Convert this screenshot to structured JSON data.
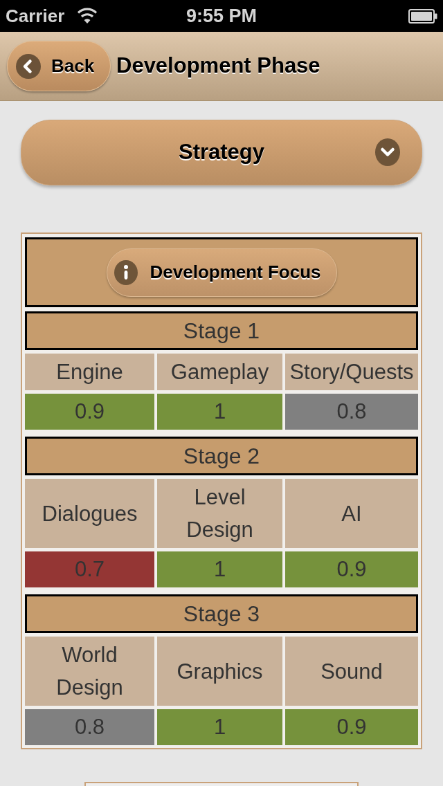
{
  "status_bar": {
    "carrier": "Carrier",
    "time": "9:55 PM"
  },
  "nav_bar": {
    "back_button": "Back",
    "title": "Development Phase"
  },
  "dropdown": {
    "value": "Strategy"
  },
  "focus_button": {
    "label": "Development Focus"
  },
  "stages": [
    {
      "title": "Stage 1",
      "metrics": [
        {
          "label": "Engine",
          "value": "0.9",
          "color": "#76923c"
        },
        {
          "label": "Gameplay",
          "value": "1",
          "color": "#76923c"
        },
        {
          "label": "Story/Quests",
          "value": "0.8",
          "color": "#808080"
        }
      ]
    },
    {
      "title": "Stage 2",
      "metrics": [
        {
          "label": "Dialogues",
          "value": "0.7",
          "color": "#943634"
        },
        {
          "label": "Level Design",
          "value": "1",
          "color": "#76923c"
        },
        {
          "label": "AI",
          "value": "0.9",
          "color": "#76923c"
        }
      ]
    },
    {
      "title": "Stage 3",
      "metrics": [
        {
          "label": "World Design",
          "value": "0.8",
          "color": "#808080"
        },
        {
          "label": "Graphics",
          "value": "1",
          "color": "#76923c"
        },
        {
          "label": "Sound",
          "value": "0.9",
          "color": "#76923c"
        }
      ]
    }
  ]
}
